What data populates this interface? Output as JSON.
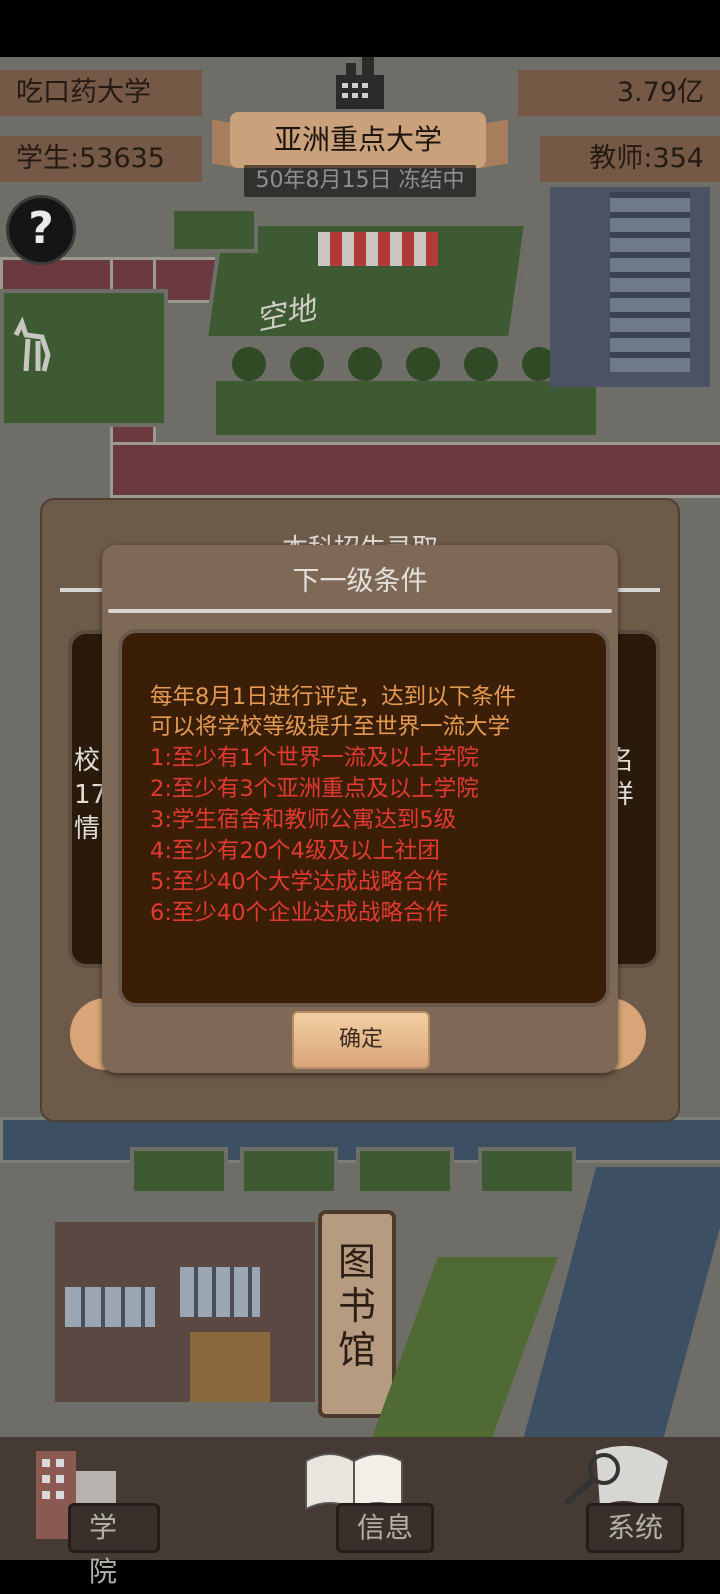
{
  "hud": {
    "school_name": "吃口药大学",
    "funds": "3.79亿",
    "students": "学生:53635",
    "teachers": "教师:354",
    "rank_banner": "亚洲重点大学",
    "date_status": "50年8月15日 冻结中",
    "help_symbol": "?"
  },
  "map_labels": {
    "vacant_lot": "空地",
    "library": "图书馆"
  },
  "back_dialog": {
    "title": "本科招生录取",
    "left_text_1": "校",
    "left_text_2": "17",
    "left_text_3": "情",
    "right_text_1": "名",
    "right_text_2": "样"
  },
  "dialog": {
    "title": "下一级条件",
    "intro_line_1": "每年8月1日进行评定，达到以下条件",
    "intro_line_2": "可以将学校等级提升至世界一流大学",
    "requirements": [
      "1:至少有1个世界一流及以上学院",
      "2:至少有3个亚洲重点及以上学院",
      "3:学生宿舍和教师公寓达到5级",
      "4:至少有20个4级及以上社团",
      "5:至少40个大学达成战略合作",
      "6:至少40个企业达成战略合作"
    ],
    "ok_label": "确定"
  },
  "bottom_nav": [
    {
      "label": "学院",
      "icon": "college-building-icon"
    },
    {
      "label": "信息",
      "icon": "open-book-icon"
    },
    {
      "label": "系统",
      "icon": "magnifier-icon"
    }
  ],
  "colors": {
    "intro_text": "#e59a54",
    "requirement_text": "#e23a32",
    "panel_bg": "#3a1e06",
    "dialog_bg": "#7e6956"
  }
}
